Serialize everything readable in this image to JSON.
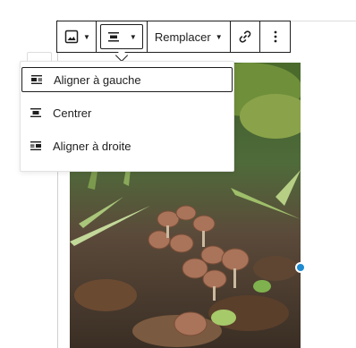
{
  "toolbar": {
    "image_icon": "image-icon",
    "align_icon": "align-center-icon",
    "replace_label": "Remplacer",
    "link_icon": "link-icon",
    "more_icon": "more-vertical-icon"
  },
  "align_menu": {
    "items": [
      {
        "label": "Aligner à gauche",
        "icon": "align-left-icon",
        "selected": true
      },
      {
        "label": "Centrer",
        "icon": "align-center-icon",
        "selected": false
      },
      {
        "label": "Aligner à droite",
        "icon": "align-right-icon",
        "selected": false
      }
    ]
  },
  "colors": {
    "handle": "#1f8bd0",
    "border": "#1e1e1e"
  }
}
